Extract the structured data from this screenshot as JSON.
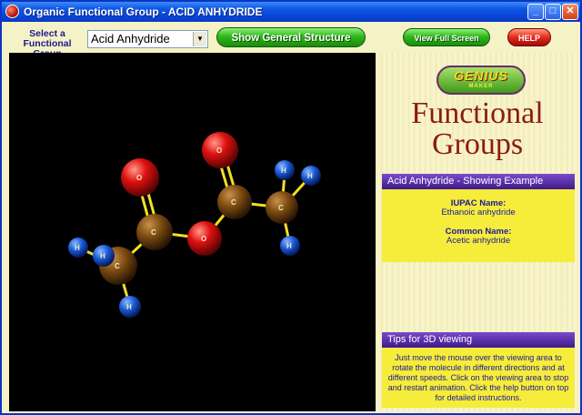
{
  "window": {
    "title": "Organic Functional Group - ACID ANHYDRIDE",
    "controls": {
      "minimize": "_",
      "maximize": "□",
      "close": "✕"
    }
  },
  "toolbar": {
    "select_label": "Select a Functional Group",
    "group_select": {
      "value": "Acid Anhydride"
    },
    "show_structure_label": "Show General Structure",
    "full_screen_label": "View Full Screen",
    "help_label": "HELP"
  },
  "molecule": {
    "atoms": [
      {
        "label": "O",
        "element": "oxygen"
      },
      {
        "label": "O",
        "element": "oxygen"
      },
      {
        "label": "O",
        "element": "oxygen"
      },
      {
        "label": "C",
        "element": "carbon"
      },
      {
        "label": "C",
        "element": "carbon"
      },
      {
        "label": "C",
        "element": "carbon"
      },
      {
        "label": "C",
        "element": "carbon"
      },
      {
        "label": "H",
        "element": "hydrogen"
      },
      {
        "label": "H",
        "element": "hydrogen"
      },
      {
        "label": "H",
        "element": "hydrogen"
      },
      {
        "label": "H",
        "element": "hydrogen"
      },
      {
        "label": "H",
        "element": "hydrogen"
      },
      {
        "label": "H",
        "element": "hydrogen"
      }
    ],
    "colors": {
      "oxygen": "#e01010",
      "carbon": "#7a4a10",
      "hydrogen": "#1a5ad8",
      "bond": "#f2e020",
      "background": "#000000"
    }
  },
  "sidebar": {
    "logo": {
      "main": "GENIUS",
      "sub": "MAKER"
    },
    "heading_line1": "Functional",
    "heading_line2": "Groups",
    "example_panel": {
      "title": "Acid Anhydride - Showing Example",
      "iupac_label": "IUPAC Name:",
      "iupac_value": "Ethanoic anhydride",
      "common_label": "Common Name:",
      "common_value": "Acetic anhydride"
    },
    "tips_panel": {
      "title": "Tips for 3D viewing",
      "text": "Just move the mouse over the viewing area to rotate the molecule in different directions and at different speeds. Click on the viewing area to stop and restart animation. Click the help button on top for detailed instructions."
    }
  }
}
